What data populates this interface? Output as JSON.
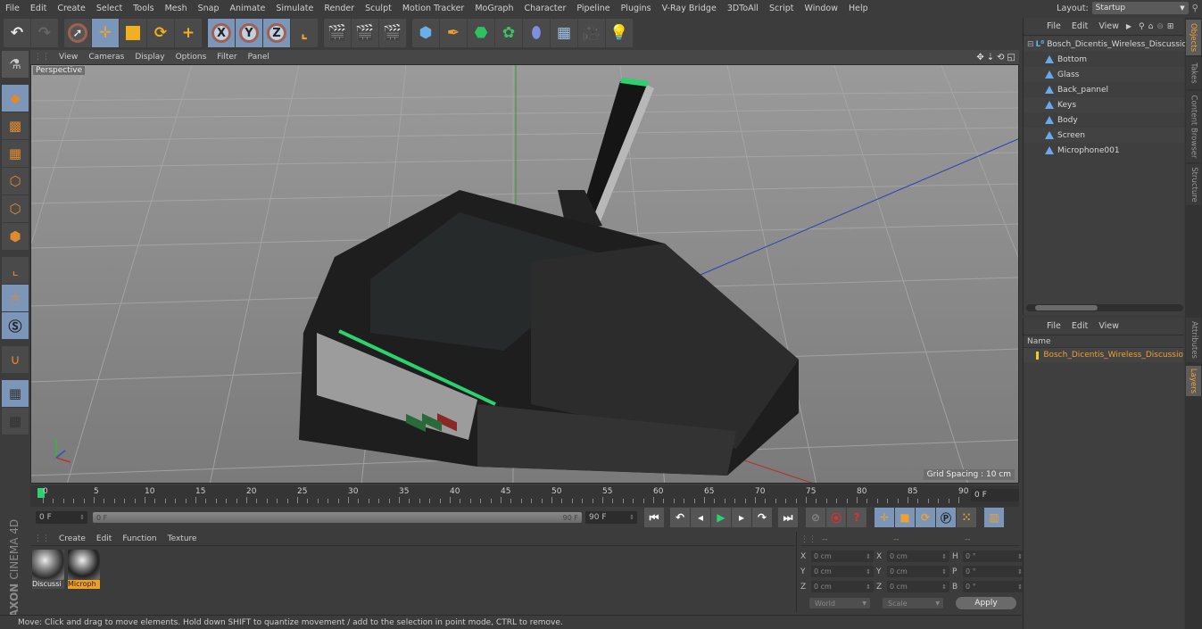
{
  "menubar": {
    "items": [
      "File",
      "Edit",
      "Create",
      "Select",
      "Tools",
      "Mesh",
      "Snap",
      "Animate",
      "Simulate",
      "Render",
      "Sculpt",
      "Motion Tracker",
      "MoGraph",
      "Character",
      "Pipeline",
      "Plugins",
      "V-Ray Bridge",
      "3DToAll",
      "Script",
      "Window",
      "Help"
    ],
    "layout_label": "Layout:",
    "layout_value": "Startup"
  },
  "toolbar": {
    "undo": "↶",
    "redo": "↷",
    "x_axis": "X",
    "y_axis": "Y",
    "z_axis": "Z"
  },
  "viewport": {
    "menu": [
      "View",
      "Cameras",
      "Display",
      "Options",
      "Filter",
      "Panel"
    ],
    "camera_label": "Perspective",
    "grid_spacing": "Grid Spacing : 10 cm",
    "colors": {
      "accent_green": "#2bd36e",
      "y_axis": "#2f9a2f",
      "x_axis": "#b03030",
      "z_axis": "#3040b0"
    }
  },
  "timeline": {
    "ticks": [
      "0",
      "5",
      "10",
      "15",
      "20",
      "25",
      "30",
      "35",
      "40",
      "45",
      "50",
      "55",
      "60",
      "65",
      "70",
      "75",
      "80",
      "85",
      "90"
    ],
    "current_frame_field": "0 F",
    "start_field": "0 F",
    "range_start": "0 F",
    "range_end": "90 F",
    "end_field": "90 F"
  },
  "materials": {
    "menu": [
      "Create",
      "Edit",
      "Function",
      "Texture"
    ],
    "items": [
      {
        "name": "Discussi",
        "selected": false
      },
      {
        "name": "Microph",
        "selected": true
      }
    ],
    "brand_top": "MAXON",
    "brand_bottom": "CINEMA 4D"
  },
  "coordinates": {
    "headers": [
      "--",
      "--",
      "--"
    ],
    "rows": [
      {
        "l1": "X",
        "v1": "0 cm",
        "l2": "X",
        "v2": "0 cm",
        "l3": "H",
        "v3": "0 °"
      },
      {
        "l1": "Y",
        "v1": "0 cm",
        "l2": "Y",
        "v2": "0 cm",
        "l3": "P",
        "v3": "0 °"
      },
      {
        "l1": "Z",
        "v1": "0 cm",
        "l2": "Z",
        "v2": "0 cm",
        "l3": "B",
        "v3": "0 °"
      }
    ],
    "space": "World",
    "mode": "Scale",
    "apply": "Apply"
  },
  "status": "Move: Click and drag to move elements. Hold down SHIFT to quantize movement / add to the selection in point mode, CTRL to remove.",
  "objects": {
    "menu": [
      "File",
      "Edit",
      "View"
    ],
    "root": "Bosch_Dicentis_Wireless_Discussio",
    "children": [
      "Bottom",
      "Glass",
      "Back_pannel",
      "Keys",
      "Body",
      "Screen",
      "Microphone001"
    ]
  },
  "layers": {
    "menu": [
      "File",
      "Edit",
      "View"
    ],
    "column": "Name",
    "items": [
      {
        "name": "Bosch_Dicentis_Wireless_Discussio",
        "color": "#e8d020"
      }
    ]
  },
  "side_tabs": {
    "top": [
      "Objects",
      "Takes",
      "Content Browser",
      "Structure"
    ],
    "bottom": [
      "Attributes",
      "Layers"
    ]
  }
}
